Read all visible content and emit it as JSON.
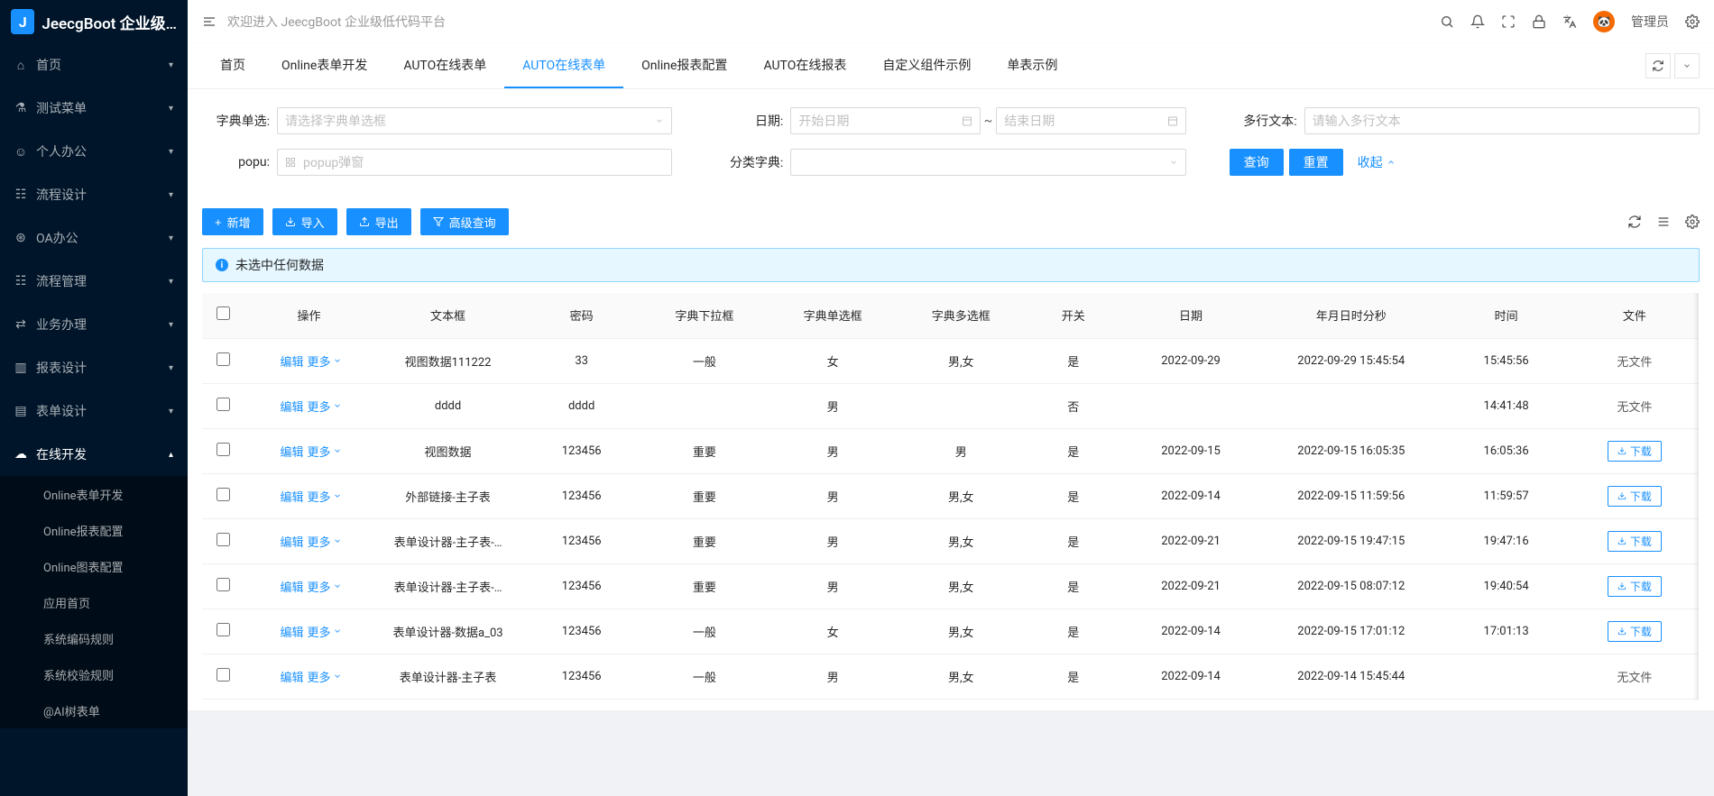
{
  "app": {
    "title": "JeecgBoot 企业级…"
  },
  "header": {
    "welcome": "欢迎进入 JeecgBoot 企业级低代码平台",
    "user": "管理员"
  },
  "sidebar": {
    "items": [
      {
        "label": "首页",
        "icon": "home"
      },
      {
        "label": "测试菜单",
        "icon": "beaker"
      },
      {
        "label": "个人办公",
        "icon": "user"
      },
      {
        "label": "流程设计",
        "icon": "tree"
      },
      {
        "label": "OA办公",
        "icon": "earth"
      },
      {
        "label": "流程管理",
        "icon": "tree"
      },
      {
        "label": "业务办理",
        "icon": "tx"
      },
      {
        "label": "报表设计",
        "icon": "report"
      },
      {
        "label": "表单设计",
        "icon": "form"
      }
    ],
    "online": {
      "label": "在线开发",
      "icon": "cloud",
      "children": [
        {
          "label": "Online表单开发"
        },
        {
          "label": "Online报表配置"
        },
        {
          "label": "Online图表配置"
        },
        {
          "label": "应用首页"
        },
        {
          "label": "系统编码规则"
        },
        {
          "label": "系统校验规则"
        },
        {
          "label": "@AI树表单"
        }
      ]
    }
  },
  "tabs": {
    "items": [
      {
        "label": "首页"
      },
      {
        "label": "Online表单开发"
      },
      {
        "label": "AUTO在线表单"
      },
      {
        "label": "AUTO在线表单",
        "active": true
      },
      {
        "label": "Online报表配置"
      },
      {
        "label": "AUTO在线报表"
      },
      {
        "label": "自定义组件示例"
      },
      {
        "label": "单表示例"
      }
    ]
  },
  "search": {
    "dict_radio": {
      "label": "字典单选:",
      "placeholder": "请选择字典单选框"
    },
    "date": {
      "label": "日期:",
      "start": "开始日期",
      "end": "结束日期"
    },
    "multiline": {
      "label": "多行文本:",
      "placeholder": "请输入多行文本"
    },
    "popu": {
      "label": "popu:",
      "placeholder": "popup弹窗"
    },
    "dict_category": {
      "label": "分类字典:"
    },
    "query": "查询",
    "reset": "重置",
    "collapse": "收起"
  },
  "toolbar": {
    "add": "新增",
    "import": "导入",
    "export": "导出",
    "adv": "高级查询"
  },
  "alert": {
    "text": "未选中任何数据"
  },
  "table": {
    "columns": [
      "操作",
      "文本框",
      "密码",
      "字典下拉框",
      "字典单选框",
      "字典多选框",
      "开关",
      "日期",
      "年月日时分秒",
      "时间",
      "文件"
    ],
    "actions": {
      "edit": "编辑",
      "more": "更多",
      "download": "下载",
      "nofile": "无文件"
    },
    "rows": [
      {
        "text": "视图数据111222",
        "pwd": "33",
        "drop": "一般",
        "radio": "女",
        "multi": "男,女",
        "sw": "是",
        "date": "2022-09-29",
        "dt": "2022-09-29 15:45:54",
        "time": "15:45:56",
        "file": "none"
      },
      {
        "text": "dddd",
        "pwd": "dddd",
        "drop": "",
        "radio": "男",
        "multi": "",
        "sw": "否",
        "date": "",
        "dt": "",
        "time": "14:41:48",
        "file": "none"
      },
      {
        "text": "视图数据",
        "pwd": "123456",
        "drop": "重要",
        "radio": "男",
        "multi": "男",
        "sw": "是",
        "date": "2022-09-15",
        "dt": "2022-09-15 16:05:35",
        "time": "16:05:36",
        "file": "dl"
      },
      {
        "text": "外部链接-主子表",
        "pwd": "123456",
        "drop": "重要",
        "radio": "男",
        "multi": "男,女",
        "sw": "是",
        "date": "2022-09-14",
        "dt": "2022-09-15 11:59:56",
        "time": "11:59:57",
        "file": "dl"
      },
      {
        "text": "表单设计器-主子表-…",
        "pwd": "123456",
        "drop": "重要",
        "radio": "男",
        "multi": "男,女",
        "sw": "是",
        "date": "2022-09-21",
        "dt": "2022-09-15 19:47:15",
        "time": "19:47:16",
        "file": "dl"
      },
      {
        "text": "表单设计器-主子表-…",
        "pwd": "123456",
        "drop": "重要",
        "radio": "男",
        "multi": "男,女",
        "sw": "是",
        "date": "2022-09-21",
        "dt": "2022-09-15 08:07:12",
        "time": "19:40:54",
        "file": "dl"
      },
      {
        "text": "表单设计器-数据a_03",
        "pwd": "123456",
        "drop": "一般",
        "radio": "女",
        "multi": "男,女",
        "sw": "是",
        "date": "2022-09-14",
        "dt": "2022-09-15 17:01:12",
        "time": "17:01:13",
        "file": "dl"
      },
      {
        "text": "表单设计器-主子表",
        "pwd": "123456",
        "drop": "一般",
        "radio": "男",
        "multi": "男,女",
        "sw": "是",
        "date": "2022-09-14",
        "dt": "2022-09-14 15:45:44",
        "time": "",
        "file": "none"
      }
    ]
  }
}
